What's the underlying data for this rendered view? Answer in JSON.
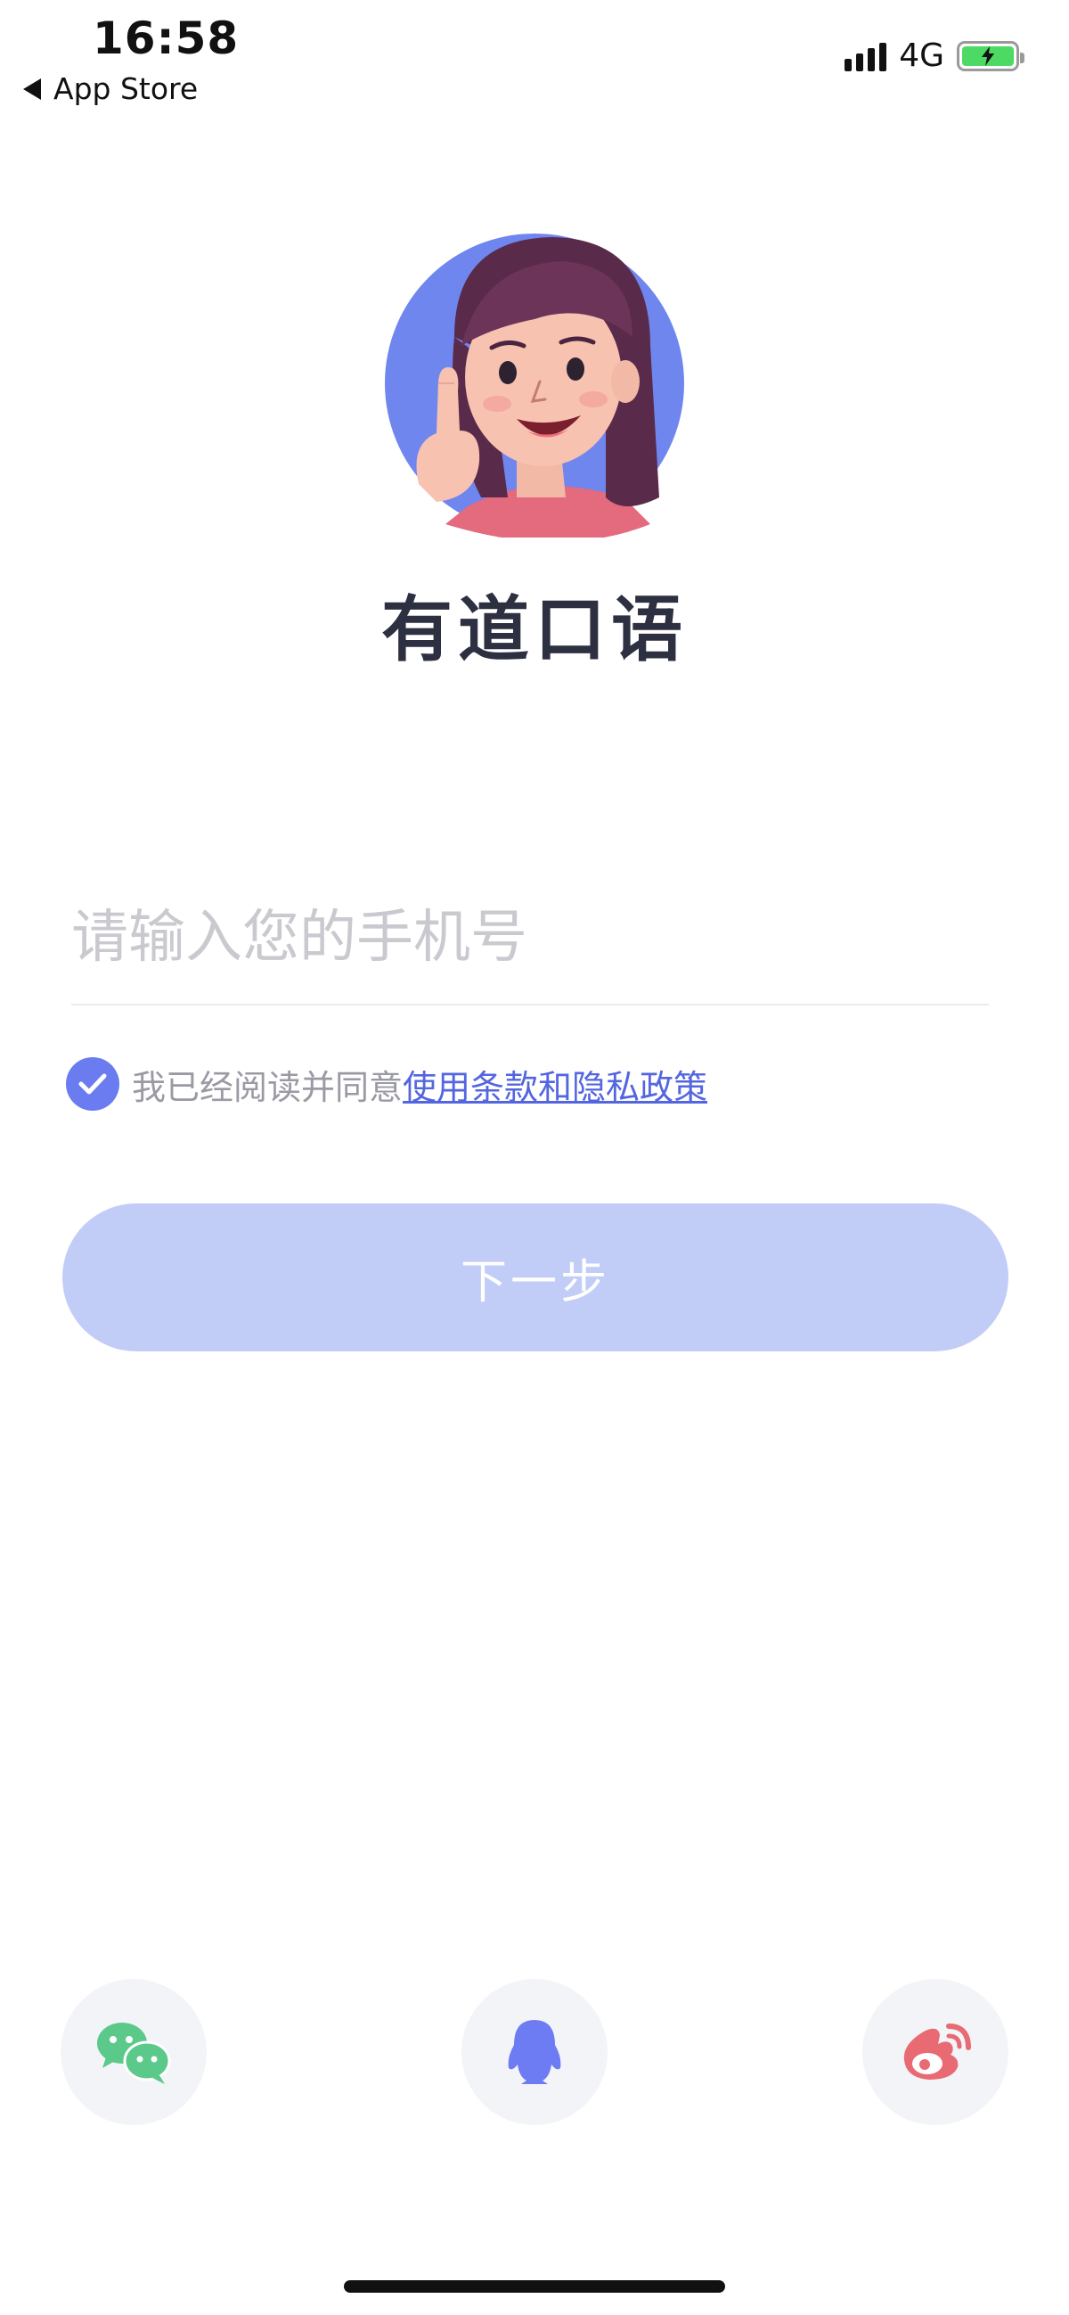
{
  "status_bar": {
    "time": "16:58",
    "back_label": "App Store",
    "network": "4G",
    "battery_charging": true
  },
  "header": {
    "app_title": "有道口语"
  },
  "login": {
    "phone_placeholder": "请输入您的手机号",
    "phone_value": "",
    "agreement_checked": true,
    "agreement_text": "我已经阅读并同意",
    "agreement_link": "使用条款和隐私政策",
    "next_label": "下一步"
  },
  "social": {
    "icons": [
      "wechat-icon",
      "qq-icon",
      "weibo-icon"
    ]
  },
  "colors": {
    "accent": "#6a7cf0",
    "button_disabled": "#c2cdf7",
    "link": "#5366e0",
    "wechat": "#5bc98a",
    "qq": "#6d7cf2",
    "weibo": "#e86a72"
  }
}
